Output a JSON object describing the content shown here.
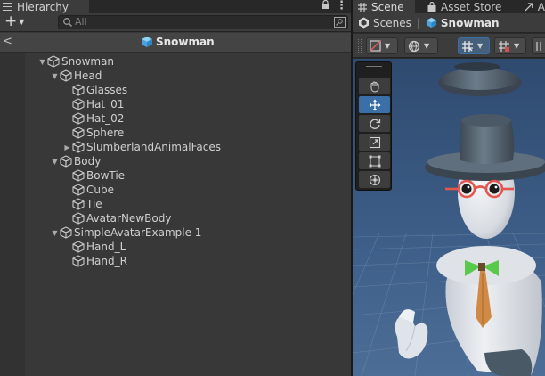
{
  "hierarchy": {
    "tab_label": "Hierarchy",
    "search_placeholder": "All",
    "scene_title": "Snowman",
    "rows": [
      {
        "label": "Snowman",
        "depth": 0,
        "expander": "open"
      },
      {
        "label": "Head",
        "depth": 1,
        "expander": "open"
      },
      {
        "label": "Glasses",
        "depth": 2,
        "expander": "none"
      },
      {
        "label": "Hat_01",
        "depth": 2,
        "expander": "none"
      },
      {
        "label": "Hat_02",
        "depth": 2,
        "expander": "none"
      },
      {
        "label": "Sphere",
        "depth": 2,
        "expander": "none"
      },
      {
        "label": "SlumberlandAnimalFaces",
        "depth": 2,
        "expander": "closed"
      },
      {
        "label": "Body",
        "depth": 1,
        "expander": "open"
      },
      {
        "label": "BowTie",
        "depth": 2,
        "expander": "none"
      },
      {
        "label": "Cube",
        "depth": 2,
        "expander": "none"
      },
      {
        "label": "Tie",
        "depth": 2,
        "expander": "none"
      },
      {
        "label": "AvatarNewBody",
        "depth": 2,
        "expander": "none"
      },
      {
        "label": "SimpleAvatarExample 1",
        "depth": 1,
        "expander": "open"
      },
      {
        "label": "Hand_L",
        "depth": 2,
        "expander": "none"
      },
      {
        "label": "Hand_R",
        "depth": 2,
        "expander": "none"
      }
    ]
  },
  "scene": {
    "tabs": [
      {
        "label": "Scene",
        "active": true,
        "icon": "grid-icon"
      },
      {
        "label": "Asset Store",
        "active": false,
        "icon": "bag-icon"
      },
      {
        "label": "A",
        "active": false,
        "icon": "animation-icon"
      }
    ],
    "breadcrumb": [
      {
        "label": "Scenes",
        "icon": "unity-icon"
      },
      {
        "label": "Snowman",
        "icon": "prefab-cube-icon"
      }
    ],
    "toolbar_icons": [
      "draw-mode-icon",
      "view-options-icon",
      "grid-snap-icon",
      "increment-snap-icon"
    ],
    "tools": [
      "hand-tool-icon",
      "move-tool-icon",
      "rotate-tool-icon",
      "scale-tool-icon",
      "rect-tool-icon",
      "transform-tool-icon"
    ],
    "active_tool": "move-tool-icon"
  },
  "colors": {
    "accent_blue": "#3a6fa8",
    "prefab_blue": "#5fb4ea",
    "sky": "#3d5f88",
    "snowman_white": "#e3e6ea",
    "hat_dark": "#4a5865",
    "glasses_red": "#e3564e",
    "bowtie_green": "#58c94b",
    "tie_orange": "#d18a46"
  }
}
